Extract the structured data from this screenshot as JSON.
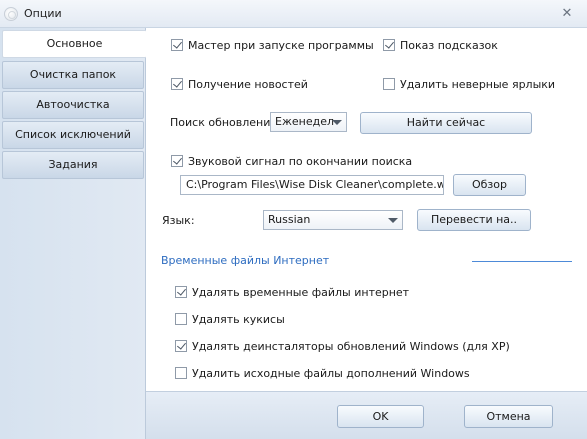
{
  "window": {
    "title": "Опции"
  },
  "sidebar": {
    "items": [
      {
        "label": "Основное",
        "active": true
      },
      {
        "label": "Очистка папок",
        "active": false
      },
      {
        "label": "Автоочистка",
        "active": false
      },
      {
        "label": "Список исключений",
        "active": false
      },
      {
        "label": "Задания",
        "active": false
      }
    ]
  },
  "general": {
    "wizard_on_start": {
      "label": "Мастер при запуске программы",
      "checked": true
    },
    "show_hints": {
      "label": "Показ подсказок",
      "checked": true
    },
    "get_news": {
      "label": "Получение новостей",
      "checked": true
    },
    "delete_bad_shortcuts": {
      "label": "Удалить неверные ярлыки",
      "checked": false
    },
    "update_search": {
      "label": "Поиск обновлений",
      "value": "Еженедел"
    },
    "find_now": "Найти сейчас",
    "sound_signal": {
      "label": "Звуковой сигнал по окончании поиска",
      "checked": true
    },
    "sound_path": "C:\\Program Files\\Wise Disk Cleaner\\complete.wav",
    "browse": "Обзор",
    "language": {
      "label": "Язык:",
      "value": "Russian"
    },
    "translate": "Перевести на.."
  },
  "internet_temp": {
    "title": "Временные файлы Интернет",
    "options": [
      {
        "label": "Удалять временные файлы интернет",
        "checked": true
      },
      {
        "label": "Удалять кукисы",
        "checked": false
      },
      {
        "label": "Удалять деинсталяторы обновлений Windows (для XP)",
        "checked": true
      },
      {
        "label": "Удалить исходные файлы дополнений Windows",
        "checked": false
      }
    ]
  },
  "footer": {
    "ok": "OK",
    "cancel": "Отмена"
  },
  "colors": {
    "accent": "#2d6cc0",
    "sidebar": "#d6e2ef",
    "content": "#ffffff"
  }
}
